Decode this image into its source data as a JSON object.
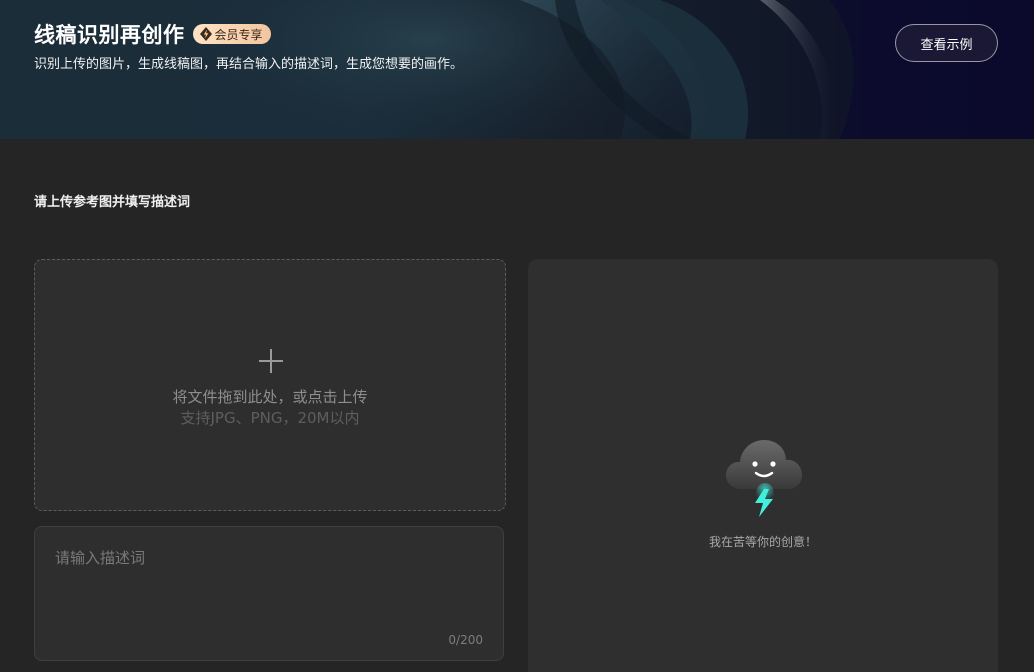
{
  "header": {
    "title": "线稿识别再创作",
    "badge": {
      "label": "会员专享",
      "icon": "lightning-icon",
      "colors": [
        "#ffe3c6",
        "#f2c59e"
      ]
    },
    "subtitle": "识别上传的图片，生成线稿图，再结合输入的描述词，生成您想要的画作。",
    "example_button": "查看示例"
  },
  "section_label": "请上传参考图并填写描述词",
  "upload": {
    "icon": "plus-icon",
    "primary_text": "将文件拖到此处，或点击上传",
    "secondary_text": "支持JPG、PNG，20M以内"
  },
  "prompt": {
    "placeholder": "请输入描述词",
    "value": "",
    "char_count": "0/200"
  },
  "result": {
    "icon": "smiling-cloud-lightning-icon",
    "waiting_text": "我在苦等你的创意！"
  },
  "colors": {
    "background": "#252525",
    "panel": "#2e2e2e",
    "accent_lightning": "#3ff0dc"
  }
}
